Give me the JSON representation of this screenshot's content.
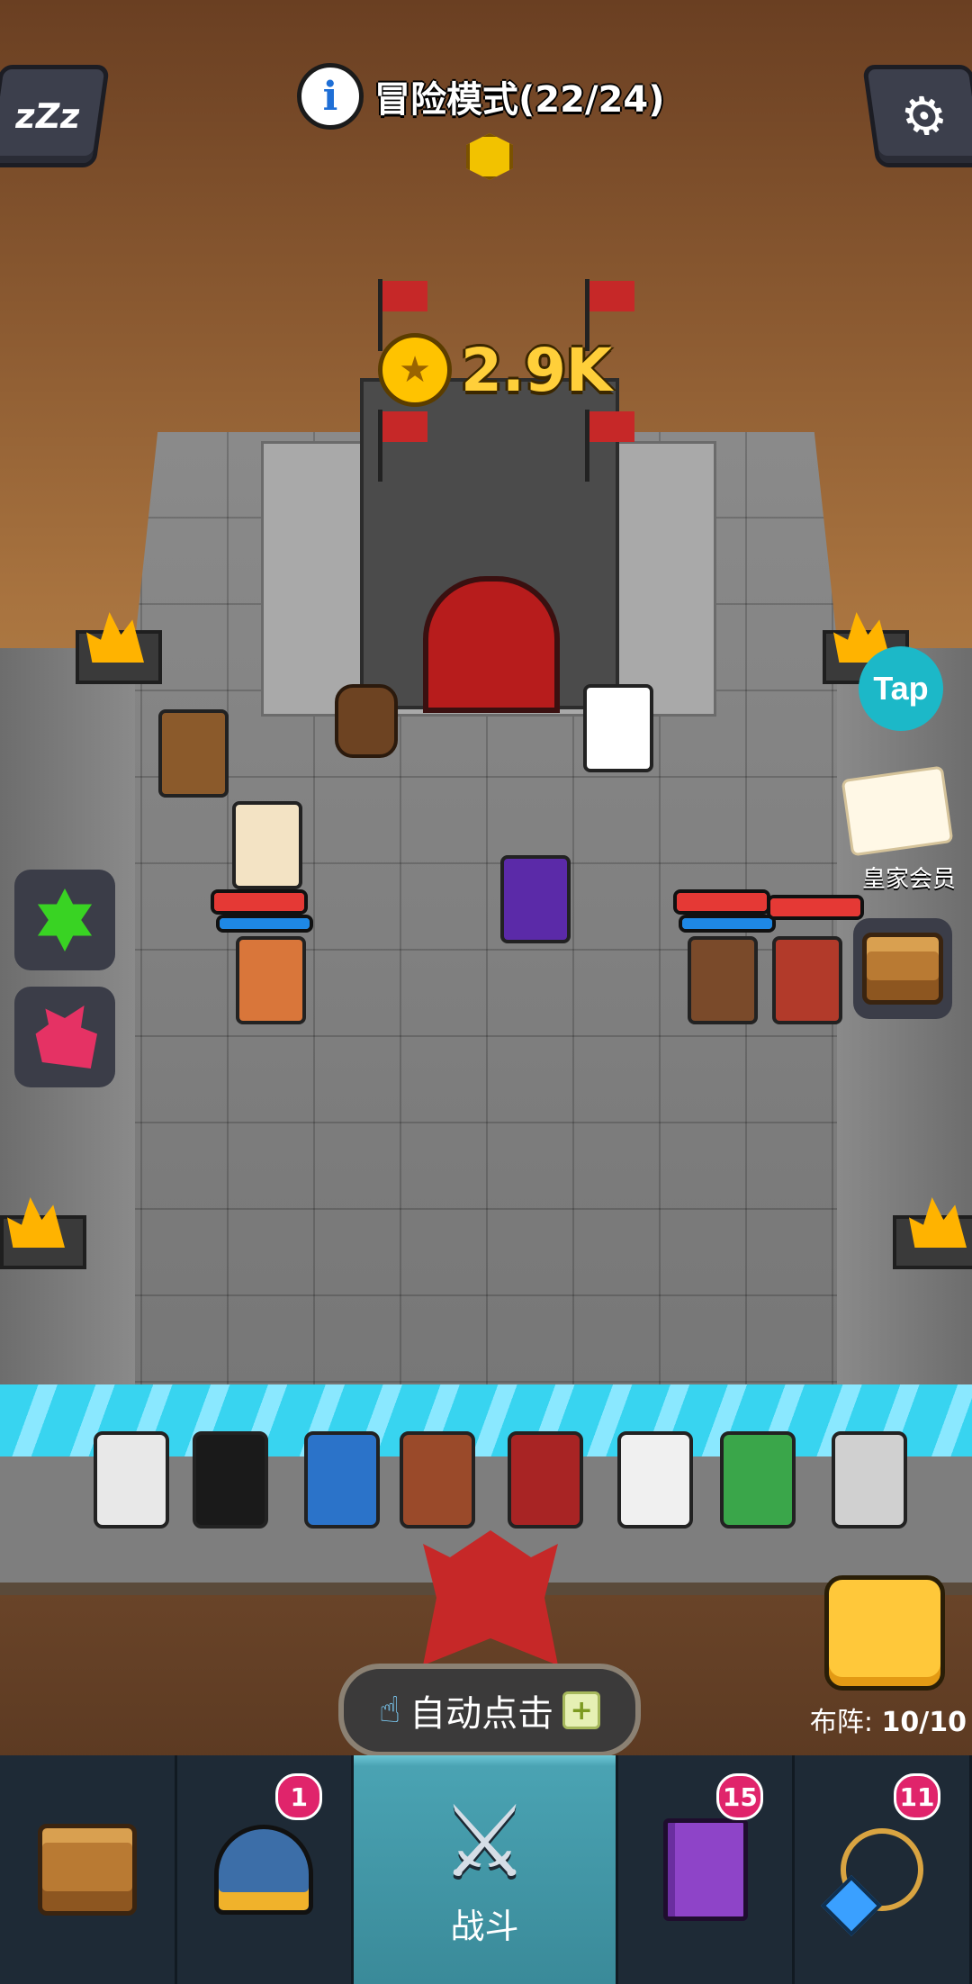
{
  "header": {
    "sleep_label": "zZz",
    "mode_title": "冒险模式(22/24)",
    "info_icon": "i",
    "settings_icon": "⚙"
  },
  "castle": {
    "coins": "2.9K"
  },
  "side": {
    "tap_label": "Tap",
    "vip_label": "皇家会员"
  },
  "formation": {
    "label": "布阵:",
    "count": "10/10"
  },
  "autoclick": {
    "label": "自动点击",
    "plus": "+",
    "hand_icon": "☝"
  },
  "nav": {
    "items": [
      {
        "name": "chest",
        "icon": "treasure-chest-icon",
        "badge": ""
      },
      {
        "name": "heroes",
        "icon": "winged-helmet-icon",
        "badge": "1"
      },
      {
        "name": "battle",
        "icon": "crossed-swords-icon",
        "label": "战斗",
        "active": true
      },
      {
        "name": "book",
        "icon": "spell-book-icon",
        "badge": "15"
      },
      {
        "name": "necklace",
        "icon": "gem-necklace-icon",
        "badge": "11"
      }
    ]
  },
  "colors": {
    "accent_gold": "#ffc83a",
    "badge_pink": "#e0246b",
    "tap_cyan": "#1cb8c8",
    "nav_active": "#4aa3b3"
  }
}
